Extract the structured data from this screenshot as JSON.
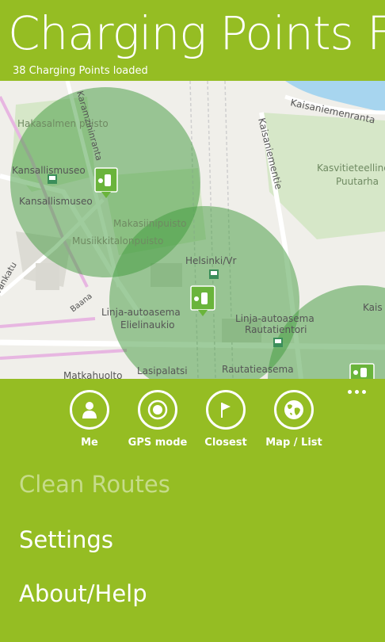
{
  "header": {
    "title": "Charging Points F",
    "status": "38 Charging Points loaded"
  },
  "map": {
    "labels": {
      "hakasalmen_puisto": "Hakasalmen puisto",
      "kansallismuseo_1": "Kansallismuseo",
      "kansallismuseo_2": "Kansallismuseo",
      "karamzinin": "Karamzininranta",
      "kaisaniemenranta": "Kaisaniemenranta",
      "kaisaniementie": "Kaisaniementie",
      "kasvitieteellinen": "Kasvitieteelline",
      "puutarha": "Puutarha",
      "makasiinipuisto": "Makasiinipuisto",
      "musiikkitalonpuisto": "Musiikkitalonpuisto",
      "helsinki_vr": "Helsinki/Vr",
      "linja_elielinaukio_1": "Linja-autoasema",
      "linja_elielinaukio_2": "Elielinaukio",
      "linja_rautatientori_1": "Linja-autoasema",
      "linja_rautatientori_2": "Rautatientori",
      "rautatieasema": "Rautatieasema",
      "lasipalatsi": "Lasipalatsi",
      "matkahuolto": "Matkahuolto",
      "baana": "Baana",
      "rankatu": "rankatu",
      "kais_right": "Kais"
    }
  },
  "appbar": {
    "buttons": [
      {
        "label": "Me",
        "icon": "person-icon"
      },
      {
        "label": "GPS mode",
        "icon": "target-icon"
      },
      {
        "label": "Closest",
        "icon": "flag-icon"
      },
      {
        "label": "Map / List",
        "icon": "globe-icon"
      }
    ],
    "menu": [
      {
        "label": "Clean Routes",
        "enabled": false
      },
      {
        "label": "Settings",
        "enabled": true
      },
      {
        "label": "About/Help",
        "enabled": true
      }
    ]
  },
  "colors": {
    "accent": "#95bd23",
    "coverage": "#3f9a3c",
    "marker": "#6ab43b",
    "water": "#a7d5ef",
    "park": "#d6e7c8"
  }
}
